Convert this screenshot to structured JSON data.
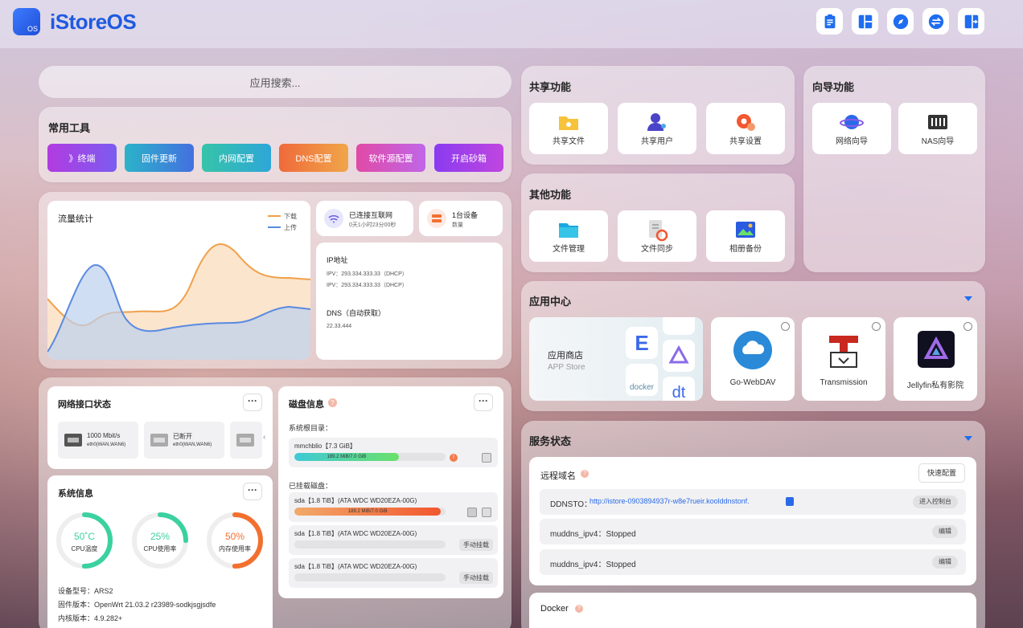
{
  "brand": "iStoreOS",
  "logo_text": "OS",
  "search_placeholder": "应用搜索...",
  "tools": {
    "title": "常用工具",
    "items": [
      "》终端",
      "固件更新",
      "内网配置",
      "DNS配置",
      "软件源配置",
      "开启砂箱"
    ]
  },
  "traffic": {
    "title": "流量统计",
    "legend_down": "下载",
    "legend_up": "上传"
  },
  "net": {
    "status": "已连接互联网",
    "uptime": "0天1小时23分00秒",
    "devices": "1台设备",
    "devices_sub": "数量",
    "ip_title": "IP地址",
    "ip1": "IPV：293.334.333.33（DHCP）",
    "ip2": "IPV：293.334.333.33（DHCP）",
    "dns_title": "DNS（自动获取）",
    "dns": "22.33.444"
  },
  "share": {
    "title": "共享功能",
    "items": [
      "共享文件",
      "共享用户",
      "共享设置"
    ]
  },
  "other": {
    "title": "其他功能",
    "items": [
      "文件管理",
      "文件同步",
      "相册备份"
    ]
  },
  "wizard": {
    "title": "向导功能",
    "items": [
      "网络向导",
      "NAS向导"
    ]
  },
  "appcenter": {
    "title": "应用中心",
    "store": "应用商店",
    "store_sub": "APP Store",
    "docker": "docker",
    "apps": [
      "Go-WebDAV",
      "Transmission",
      "Jellyfin私有影院"
    ]
  },
  "netif": {
    "title": "网络接口状态",
    "more": "···",
    "ports": [
      {
        "speed": "1000 Mbit/s",
        "name": "eth0(WAN,WAN6)"
      },
      {
        "speed": "已断开",
        "name": "eth0(WAN,WAN6)"
      }
    ]
  },
  "sysinfo": {
    "title": "系统信息",
    "more": "···",
    "gauges": [
      {
        "value": "50˚C",
        "label": "CPU温度",
        "pct": 0.5,
        "color": "#3bd1a0"
      },
      {
        "value": "25%",
        "label": "CPU使用率",
        "pct": 0.25,
        "color": "#3bd1a0"
      },
      {
        "value": "50%",
        "label": "内存使用率",
        "pct": 0.5,
        "color": "#f2702f"
      }
    ],
    "model": "设备型号：ARS2",
    "firmware": "固件版本：OpenWrt 21.03.2 r23989-sodkjsgjsdfe",
    "kernel": "内核版本：4.9.282+"
  },
  "disk": {
    "title": "磁盘信息",
    "more": "···",
    "root_label": "系统根目录：",
    "root": {
      "name": "mmchblio【7.3 GiB】",
      "used": "189.2 MiB/7.0 GiB",
      "pct": 0.69
    },
    "mounted_label": "已挂载磁盘：",
    "disks": [
      {
        "name": "sda【1.8 TiB】(ATA WDC WD20EZA-00G)",
        "used": "189.2 MiB/7.0 GiB",
        "pct": 0.97,
        "btn": ""
      },
      {
        "name": "sda【1.8 TiB】(ATA WDC WD20EZA-00G)",
        "used": "",
        "pct": 0,
        "btn": "手动挂载"
      },
      {
        "name": "sda【1.8 TiB】(ATA WDC WD20EZA-00G)",
        "used": "",
        "pct": 0,
        "btn": "手动挂载"
      }
    ]
  },
  "service": {
    "title": "服务状态",
    "remote": "远程域名",
    "quick": "快速配置",
    "ddnsto_label": "DDNSTO：",
    "ddnsto_url": "http://istore-0903894937r-w8e7rueir.kooldd​nstonf.",
    "ddnsto_btn": "进入控制台",
    "rows": [
      {
        "text": "muddns_ipv4：Stopped",
        "btn": "编辑"
      },
      {
        "text": "muddns_ipv4：Stopped",
        "btn": "编辑"
      }
    ],
    "docker": "Docker"
  }
}
